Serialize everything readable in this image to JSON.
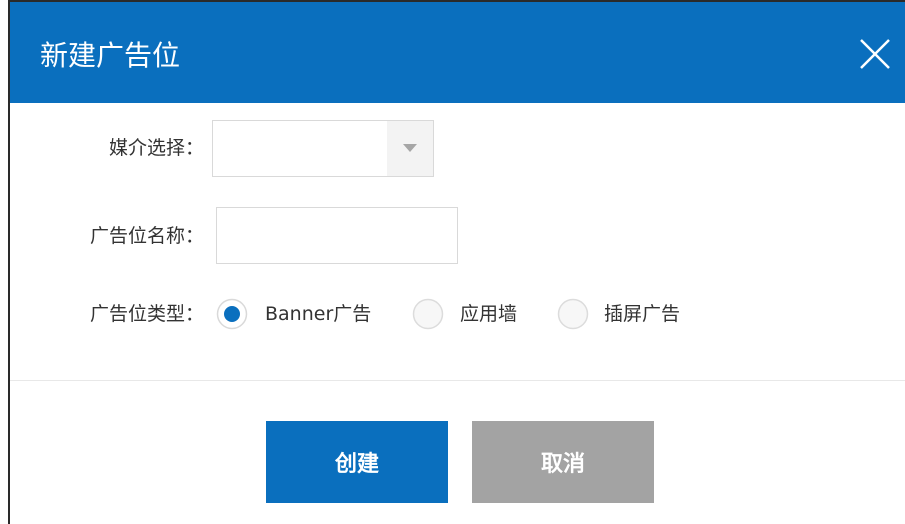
{
  "dialog": {
    "title": "新建广告位",
    "close_icon": "close-icon"
  },
  "form": {
    "media_label": "媒介选择：",
    "media_value": "",
    "name_label": "广告位名称：",
    "name_value": "",
    "type_label": "广告位类型：",
    "type_options": [
      {
        "label": "Banner广告",
        "selected": true
      },
      {
        "label": "应用墙",
        "selected": false
      },
      {
        "label": "插屏广告",
        "selected": false
      }
    ]
  },
  "actions": {
    "create_label": "创建",
    "cancel_label": "取消"
  },
  "colors": {
    "accent": "#0a6fbe",
    "cancel": "#a3a3a3"
  }
}
